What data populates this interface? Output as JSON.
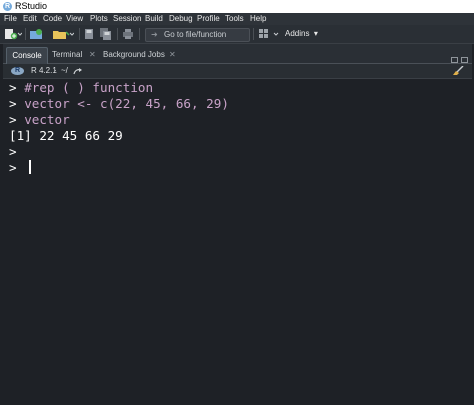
{
  "app": {
    "title": "RStudio",
    "logo_letter": "R"
  },
  "menu": [
    "File",
    "Edit",
    "Code",
    "View",
    "Plots",
    "Session",
    "Build",
    "Debug",
    "Profile",
    "Tools",
    "Help"
  ],
  "toolbar": {
    "goto_placeholder": "Go to file/function",
    "addins_label": "Addins"
  },
  "tabs": [
    {
      "label": "Console",
      "active": true
    },
    {
      "label": "Terminal",
      "closable": true
    },
    {
      "label": "Background Jobs",
      "closable": true
    }
  ],
  "pathbar": {
    "logo_letter": "R",
    "version": "R 4.2.1",
    "separator": "·",
    "directory": "~/"
  },
  "console": {
    "lines": [
      {
        "prompt": ">",
        "text": "#rep ( ) function",
        "kind": "input"
      },
      {
        "prompt": ">",
        "text": "vector <- c(22, 45, 66, 29)",
        "kind": "input"
      },
      {
        "prompt": ">",
        "text": "vector",
        "kind": "input"
      },
      {
        "prompt": "",
        "text": "[1] 22 45 66 29",
        "kind": "output"
      },
      {
        "prompt": ">",
        "text": "",
        "kind": "input"
      },
      {
        "prompt": ">",
        "text": "",
        "kind": "input"
      }
    ]
  },
  "colors": {
    "console_bg": "#1e2126",
    "input_text": "#c8a2c8",
    "output_text": "#ffffff",
    "chrome_bg": "#2a2f35",
    "accent": "#75aadb"
  }
}
